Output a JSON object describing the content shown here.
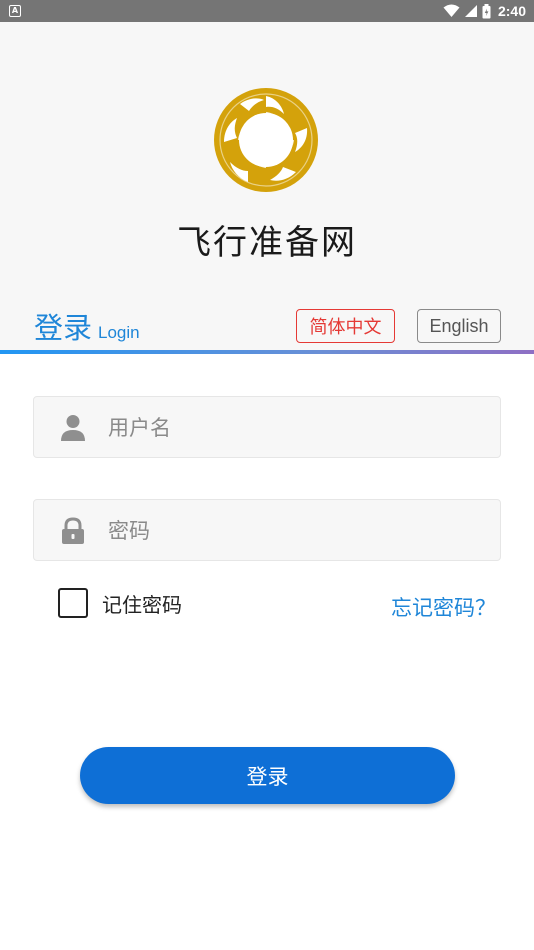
{
  "status_bar": {
    "notification_glyph": "A",
    "time": "2:40"
  },
  "header": {
    "app_title": "飞行准备网"
  },
  "login_heading": {
    "cn": "登录",
    "en": "Login"
  },
  "language": {
    "zh_label": "简体中文",
    "en_label": "English",
    "selected": "简体中文"
  },
  "form": {
    "username_placeholder": "用户名",
    "password_placeholder": "密码",
    "remember_label": "记住密码",
    "forgot_label": "忘记密码？",
    "submit_label": "登录"
  },
  "colors": {
    "accent": "#1f86d8",
    "button": "#0e6fd6",
    "selected_lang": "#e53935",
    "logo_gold": "#d4a20b"
  }
}
